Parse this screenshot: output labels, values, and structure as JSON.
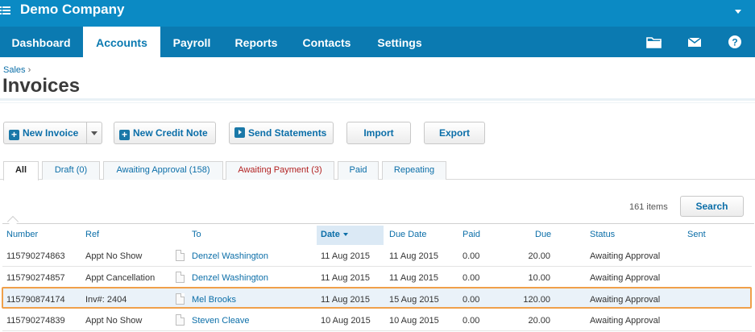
{
  "app": {
    "company": "Demo Company"
  },
  "nav": {
    "items": [
      "Dashboard",
      "Accounts",
      "Payroll",
      "Reports",
      "Contacts",
      "Settings"
    ],
    "active": "Accounts",
    "icons": [
      "folder-icon",
      "mail-icon",
      "help-icon"
    ]
  },
  "page": {
    "breadcrumb": "Sales",
    "breadcrumb_sep": "›",
    "title": "Invoices"
  },
  "toolbar": {
    "new_invoice": "New Invoice",
    "new_credit_note": "New Credit Note",
    "send_statements": "Send Statements",
    "import": "Import",
    "export": "Export"
  },
  "tabs": [
    {
      "label": "All"
    },
    {
      "label": "Draft (0)"
    },
    {
      "label": "Awaiting Approval (158)"
    },
    {
      "label": "Awaiting Payment (3)"
    },
    {
      "label": "Paid"
    },
    {
      "label": "Repeating"
    }
  ],
  "list": {
    "count": "161 items",
    "search_label": "Search"
  },
  "table": {
    "headers": {
      "number": "Number",
      "ref": "Ref",
      "to": "To",
      "date": "Date",
      "due_date": "Due Date",
      "paid": "Paid",
      "due": "Due",
      "status": "Status",
      "sent": "Sent"
    },
    "rows": [
      {
        "number": "115790274863",
        "ref": "Appt No Show",
        "to": "Denzel Washington",
        "date": "11 Aug 2015",
        "due_date": "11 Aug 2015",
        "paid": "0.00",
        "due": "20.00",
        "status": "Awaiting Approval",
        "sent": ""
      },
      {
        "number": "115790274857",
        "ref": "Appt Cancellation",
        "to": "Denzel Washington",
        "date": "11 Aug 2015",
        "due_date": "11 Aug 2015",
        "paid": "0.00",
        "due": "10.00",
        "status": "Awaiting Approval",
        "sent": ""
      },
      {
        "number": "115790874174",
        "ref": "Inv#:  2404",
        "to": "Mel Brooks",
        "date": "11 Aug 2015",
        "due_date": "15 Aug 2015",
        "paid": "0.00",
        "due": "120.00",
        "status": "Awaiting Approval",
        "sent": ""
      },
      {
        "number": "115790274839",
        "ref": "Appt No Show",
        "to": "Steven Cleave",
        "date": "10 Aug 2015",
        "due_date": "10 Aug 2015",
        "paid": "0.00",
        "due": "20.00",
        "status": "Awaiting Approval",
        "sent": ""
      }
    ]
  },
  "colors": {
    "topbar": "#0b8ac4",
    "navbar": "#0b7ab1",
    "link": "#0b6ea8",
    "highlight_border": "#f0a04a"
  }
}
